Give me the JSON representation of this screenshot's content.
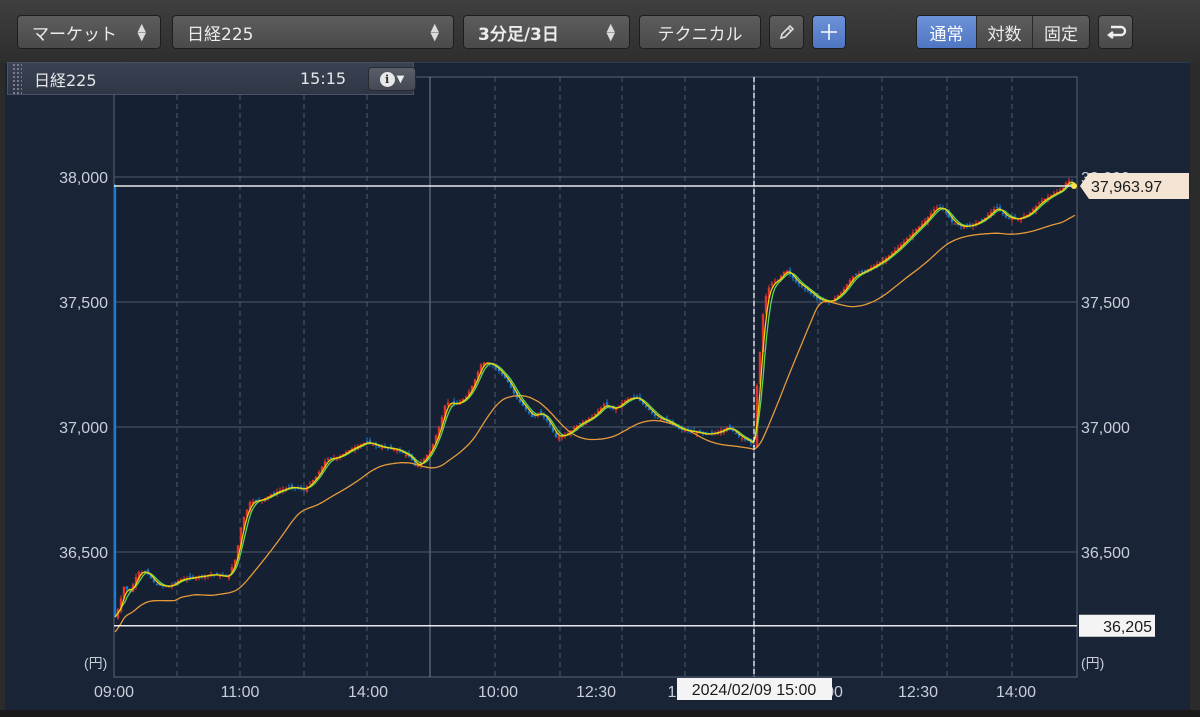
{
  "toolbar": {
    "market_select": "マーケット",
    "symbol_select": "日経225",
    "period_select": "3分足/3日",
    "technical_button": "テクニカル",
    "pencil_icon": "pencil-icon",
    "crosshair_icon": "plus-icon",
    "scale_modes": [
      "通常",
      "対数",
      "固定"
    ],
    "active_scale_mode": "通常",
    "undo_icon": "undo-icon"
  },
  "info_box": {
    "symbol": "日経225",
    "time": "15:15",
    "info_icon": "info-icon"
  },
  "chart_data": {
    "type": "candlestick",
    "y_unit_label": "(円)",
    "ylim": [
      36000,
      38400
    ],
    "y_ticks": [
      {
        "value": 38000,
        "label": "38,000"
      },
      {
        "value": 37500,
        "label": "37,500"
      },
      {
        "value": 37000,
        "label": "37,000"
      },
      {
        "value": 36500,
        "label": "36,500"
      }
    ],
    "x_tick_labels": [
      "09:00",
      "11:00",
      "14:00",
      "10:00",
      "12:30",
      "1",
      "00",
      "12:30",
      "14:00"
    ],
    "sessions": [
      {
        "open": 36230,
        "close": 36900
      },
      {
        "open": 36830,
        "close": 36950
      },
      {
        "open": 37170,
        "close": 37990
      }
    ],
    "current_price": 37963.97,
    "current_price_label": "37,963.97",
    "low_line_label": "36,205",
    "low_line_value": 36205,
    "crosshair_date_label": "2024/02/09 15:00",
    "moving_averages": [
      {
        "color": "#ffd200"
      },
      {
        "color": "#5fd35f"
      },
      {
        "color": "#e59a3a"
      }
    ],
    "colors": {
      "up": "#e0342e",
      "down": "#1f7ac9",
      "grid": "#4a5568",
      "crosshair": "#ffffff"
    }
  }
}
